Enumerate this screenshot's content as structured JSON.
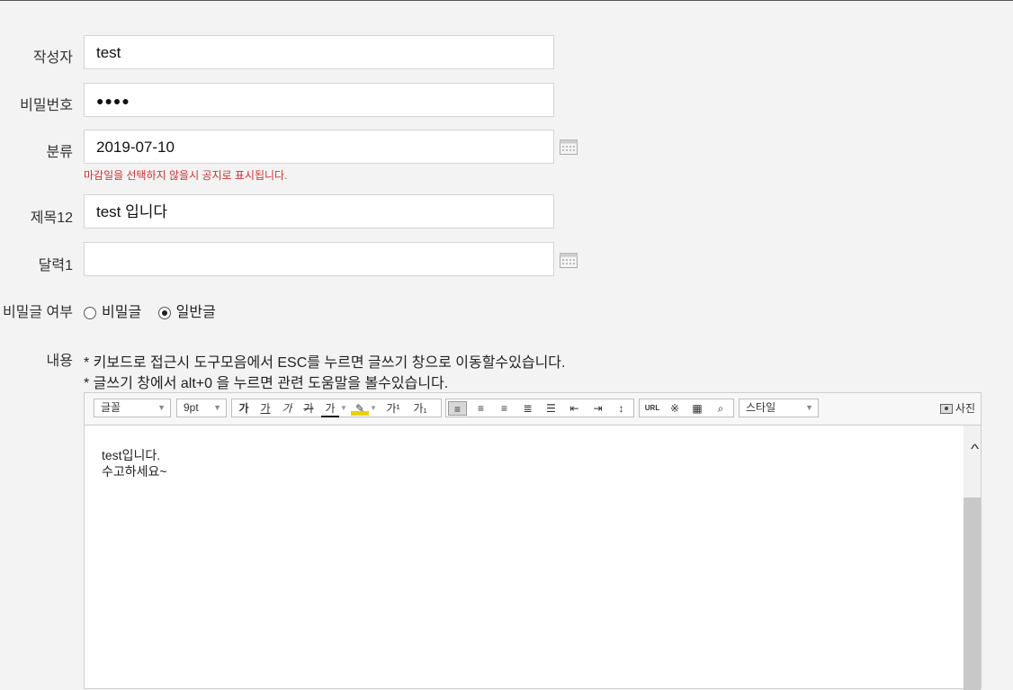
{
  "form": {
    "author": {
      "label": "작성자",
      "value": "test"
    },
    "password": {
      "label": "비밀번호",
      "value": "●●●●"
    },
    "category": {
      "label": "분류",
      "value": "2019-07-10",
      "hint": "마감일을 선택하지 않을시 공지로 표시됩니다."
    },
    "title": {
      "label": "제목12",
      "value": "test 입니다"
    },
    "calendar": {
      "label": "달력1",
      "value": ""
    },
    "secret": {
      "label": "비밀글 여부",
      "options": [
        "비밀글",
        "일반글"
      ],
      "selected": "일반글"
    },
    "content_label": "내용",
    "notes": [
      "* 키보드로 접근시 도구모음에서 ESC를 누르면 글쓰기 창으로 이동할수있습니다.",
      "* 글쓰기 창에서 alt+0 을 누르면 관련 도움말을 볼수있습니다."
    ]
  },
  "editor": {
    "font_select": "글꼴",
    "size_select": "9pt",
    "style_select": "스타일",
    "photo_label": "사진",
    "format_buttons": [
      "가",
      "가",
      "가",
      "가",
      "가",
      "가",
      "가¹",
      "가₁"
    ],
    "content_lines": [
      "test입니다.",
      "수고하세요~"
    ]
  }
}
